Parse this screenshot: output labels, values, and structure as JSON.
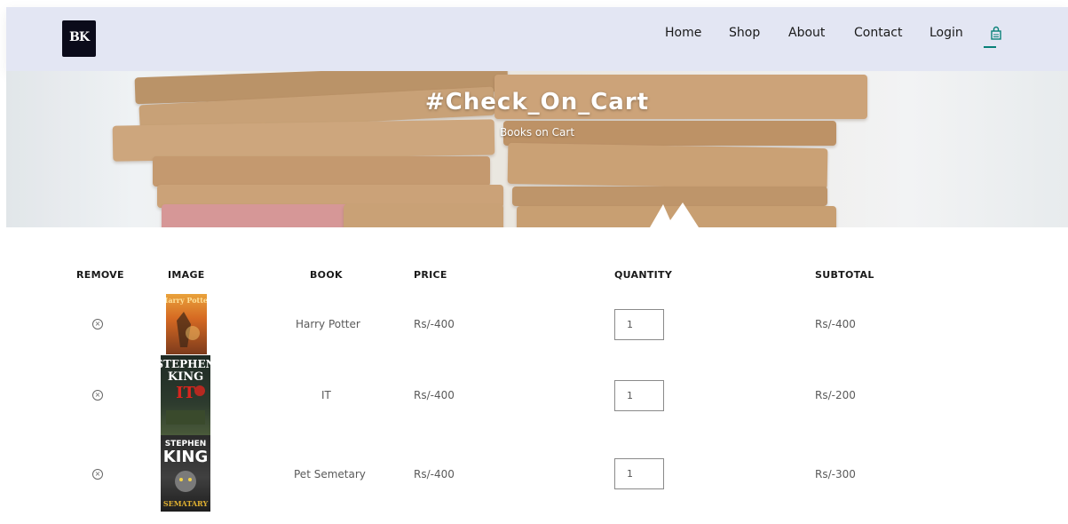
{
  "brand": {
    "logo_text": "BK"
  },
  "nav": {
    "items": [
      {
        "label": "Home"
      },
      {
        "label": "Shop"
      },
      {
        "label": "About"
      },
      {
        "label": "Contact"
      },
      {
        "label": "Login"
      }
    ],
    "cart_icon": "shopping-bag-icon",
    "accent_color": "#088178"
  },
  "banner": {
    "title": "#Check_On_Cart",
    "subtitle": "Books on Cart"
  },
  "cart": {
    "headers": [
      "REMOVE",
      "IMAGE",
      "BOOK",
      "PRICE",
      "QUANTITY",
      "SUBTOTAL"
    ],
    "remove_icon": "remove-circle-x-icon",
    "rows": [
      {
        "book": "Harry Potter",
        "price": "Rs/-400",
        "quantity": "1",
        "subtotal": "Rs/-400",
        "cover": "harry-potter-cover"
      },
      {
        "book": "IT",
        "price": "Rs/-400",
        "quantity": "1",
        "subtotal": "Rs/-200",
        "cover": "stephen-king-it-cover"
      },
      {
        "book": "Pet Semetary",
        "price": "Rs/-400",
        "quantity": "1",
        "subtotal": "Rs/-300",
        "cover": "pet-sematary-cover"
      }
    ]
  }
}
